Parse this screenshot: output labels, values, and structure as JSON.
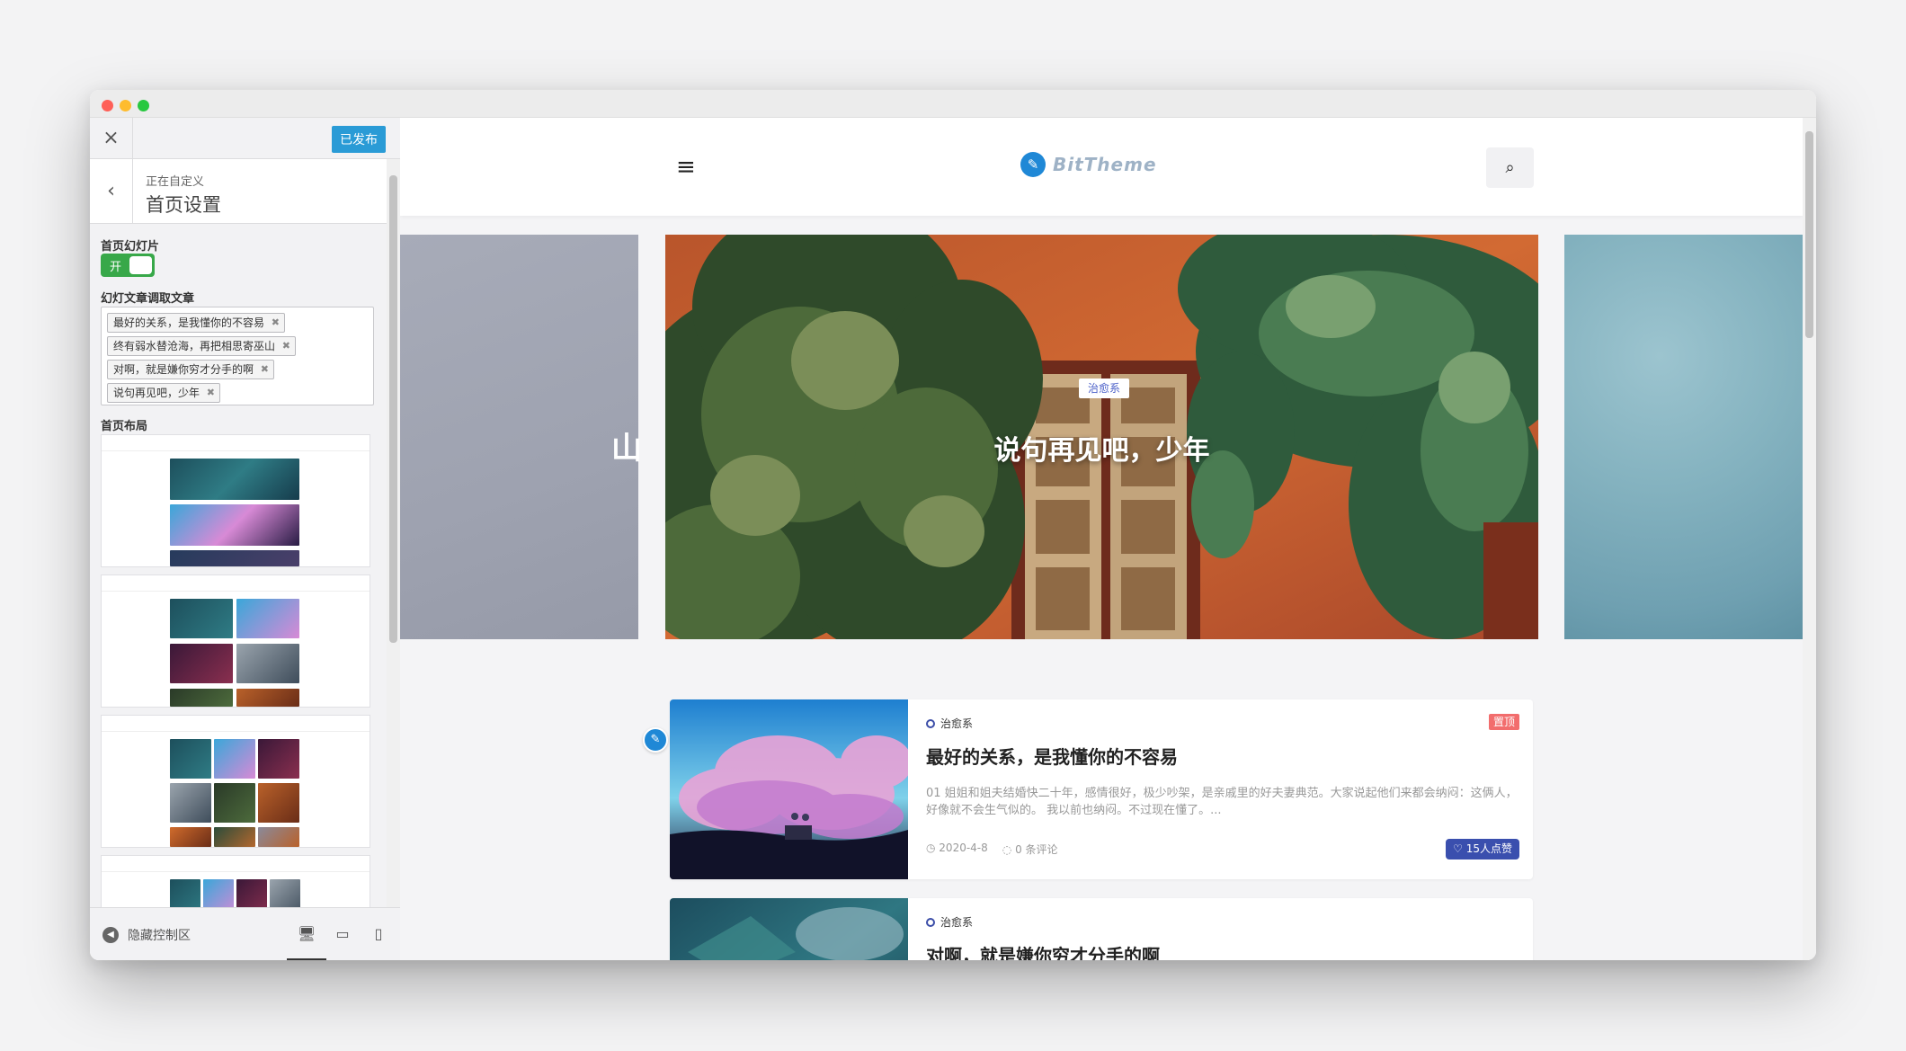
{
  "sidebar": {
    "close_icon": "×",
    "publish_label": "已发布",
    "back_icon": "‹",
    "subtitle": "正在自定义",
    "title": "首页设置",
    "slideshow_label": "首页幻灯片",
    "toggle_label": "开",
    "slide_posts_label": "幻灯文章调取文章",
    "slide_posts": [
      "最好的关系，是我懂你的不容易",
      "终有弱水替沧海，再把相思寄巫山",
      "对啊，就是嫌你穷才分手的啊",
      "说句再见吧，少年"
    ],
    "tag_remove": "✖",
    "layout_label": "首页布局",
    "hide_controls_label": "隐藏控制区",
    "devices": [
      "desktop-icon",
      "tablet-icon",
      "mobile-icon"
    ]
  },
  "preview": {
    "logo_text": "BitTheme",
    "hamburger_icon": "≡",
    "search_icon": "⌕",
    "slider": {
      "left_peek_text": "山",
      "category": "治愈系",
      "title": "说句再见吧，少年"
    },
    "posts": [
      {
        "category": "治愈系",
        "title": "最好的关系，是我懂你的不容易",
        "excerpt": "01 姐姐和姐夫结婚快二十年，感情很好，极少吵架，是亲戚里的好夫妻典范。大家说起他们来都会纳闷：这俩人，好像就不会生气似的。 我以前也纳闷。不过现在懂了。...",
        "date": "2020-4-8",
        "comments": "0 条评论",
        "sticky": "置顶",
        "likes": "15人点赞"
      },
      {
        "category": "治愈系",
        "title": "对啊，就是嫌你穷才分手的啊"
      }
    ]
  },
  "colors": {
    "accent": "#2a9bd6",
    "toggle_on": "#38a849",
    "like": "#3a4fae",
    "sticky": "#f26d6d"
  }
}
